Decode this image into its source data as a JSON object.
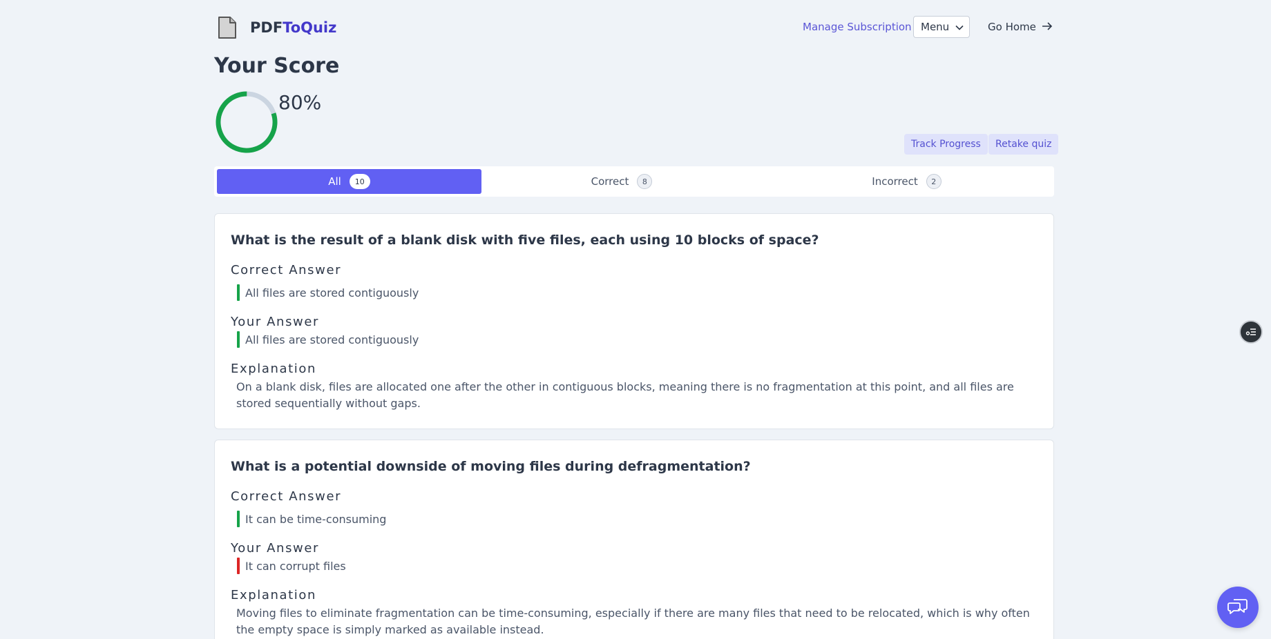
{
  "header": {
    "brand_part1": "PDF",
    "brand_part2": "ToQuiz",
    "manage_subscription": "Manage Subscription",
    "menu_label": "Menu",
    "go_home": "Go Home"
  },
  "score": {
    "title": "Your Score",
    "percent_label": "80%",
    "percent_value": 80,
    "ring_color": "#16a34a",
    "ring_track_color": "#cbd5e1"
  },
  "actions": {
    "track_progress": "Track Progress",
    "retake_quiz": "Retake quiz"
  },
  "tabs": [
    {
      "label": "All",
      "count": "10",
      "active": true
    },
    {
      "label": "Correct",
      "count": "8",
      "active": false
    },
    {
      "label": "Incorrect",
      "count": "2",
      "active": false
    }
  ],
  "labels": {
    "correct_answer": "Correct Answer",
    "your_answer": "Your Answer",
    "explanation": "Explanation"
  },
  "questions": [
    {
      "question": "What is the result of a blank disk with five files, each using 10 blocks of space?",
      "correct_answer": "All files are stored contiguously",
      "your_answer": "All files are stored contiguously",
      "is_correct": true,
      "explanation": "On a blank disk, files are allocated one after the other in contiguous blocks, meaning there is no fragmentation at this point, and all files are stored sequentially without gaps."
    },
    {
      "question": "What is a potential downside of moving files during defragmentation?",
      "correct_answer": "It can be time-consuming",
      "your_answer": "It can corrupt files",
      "is_correct": false,
      "explanation": "Moving files to eliminate fragmentation can be time-consuming, especially if there are many files that need to be relocated, which is why often the empty space is simply marked as available instead."
    }
  ],
  "colors": {
    "accent": "#6160f3",
    "correct": "#16a34a",
    "incorrect": "#dc2626"
  }
}
